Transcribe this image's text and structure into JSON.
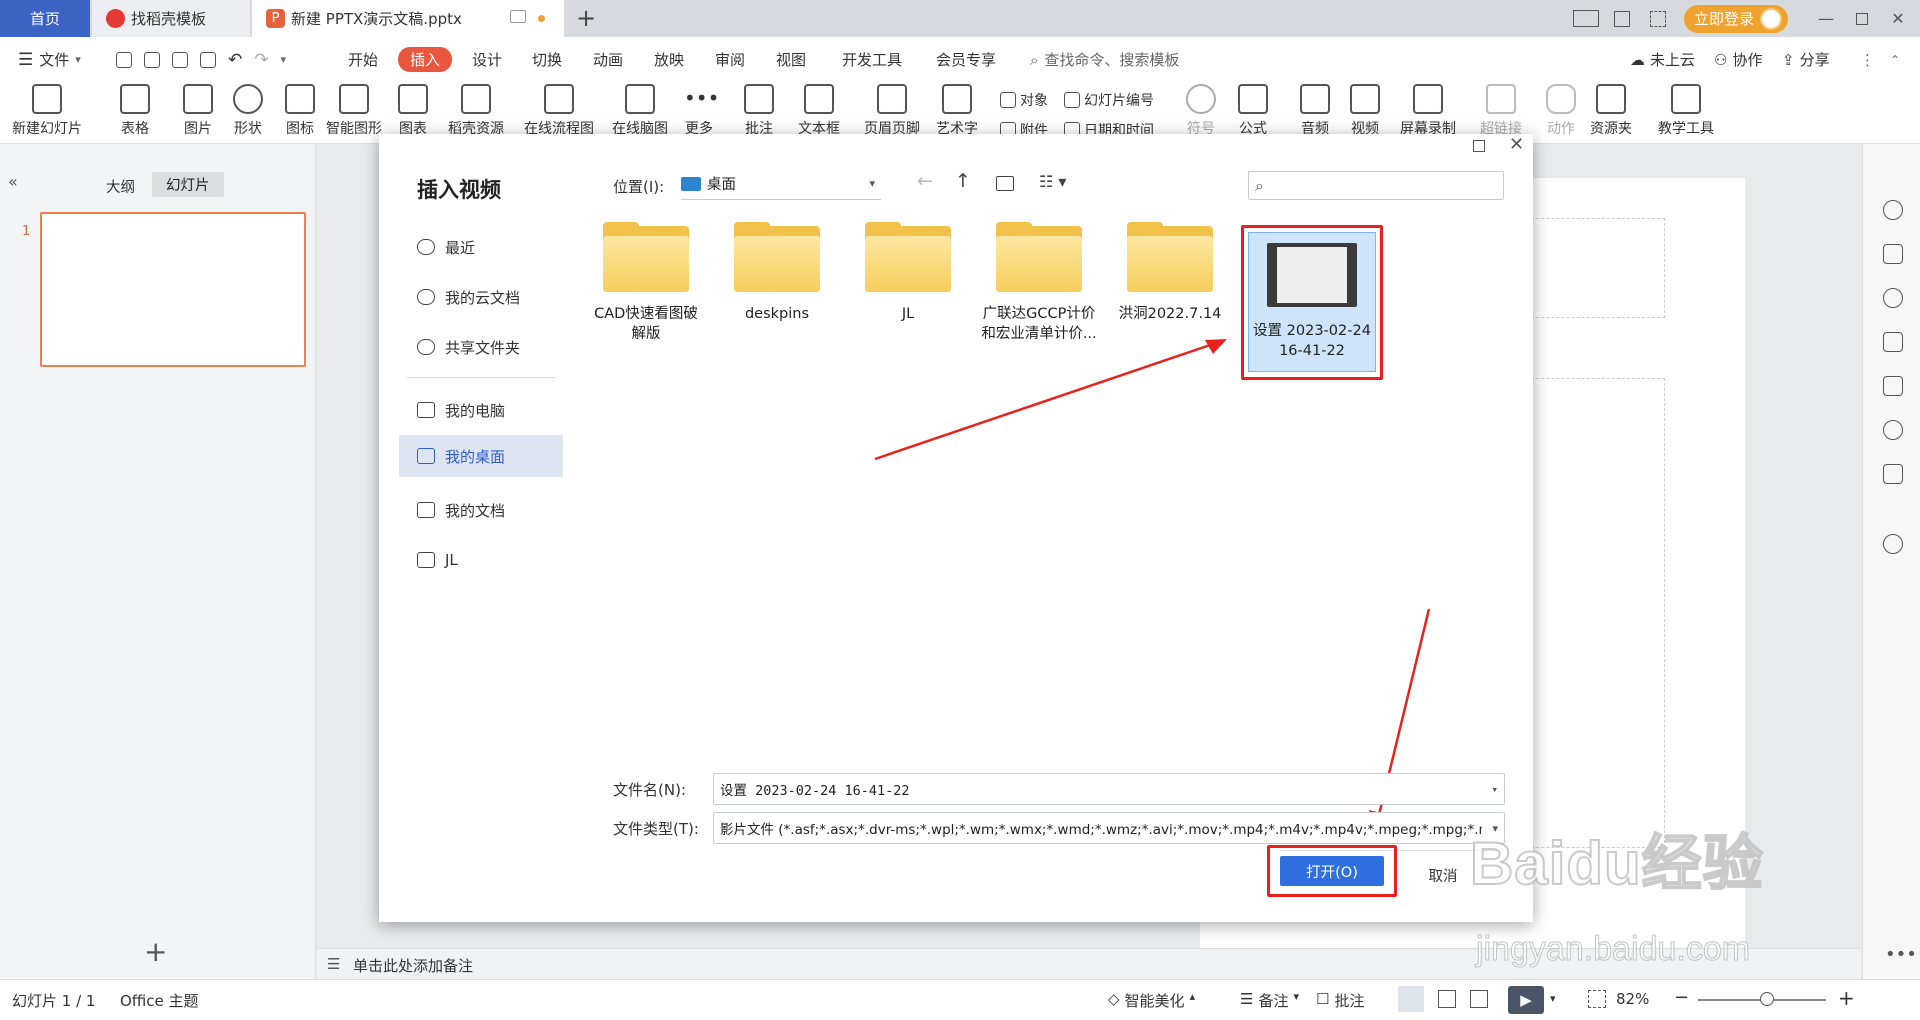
{
  "titlebar": {
    "home_tab": "首页",
    "template_tab": "找稻壳模板",
    "doc_tab": "新建 PPTX演示文稿.pptx",
    "login": "立即登录",
    "new_tab_icon": "plus-icon"
  },
  "menu": {
    "file": "文件",
    "items": [
      "开始",
      "插入",
      "设计",
      "切换",
      "动画",
      "放映",
      "审阅",
      "视图",
      "开发工具",
      "会员专享"
    ],
    "active": "插入",
    "search": "查找命令、搜索模板",
    "cloud": "未上云",
    "collab": "协作",
    "share": "分享"
  },
  "ribbon": {
    "new_slide": "新建幻灯片",
    "table": "表格",
    "picture": "图片",
    "shape": "形状",
    "icon": "图标",
    "smartart": "智能图形",
    "chart": "图表",
    "material": "稻壳资源",
    "flowchart": "在线流程图",
    "mindmap": "在线脑图",
    "more": "更多",
    "comment": "批注",
    "textbox": "文本框",
    "header_footer": "页眉页脚",
    "wordart": "艺术字",
    "object": "对象",
    "slide_number": "幻灯片编号",
    "attachment": "附件",
    "datetime": "日期和时间",
    "symbol": "符号",
    "formula": "公式",
    "audio": "音频",
    "video": "视频",
    "screen_record": "屏幕录制",
    "hyperlink": "超链接",
    "action": "动作",
    "resource": "资源夹",
    "teaching": "教学工具"
  },
  "leftpanel": {
    "outline_tab": "大纲",
    "slides_tab": "幻灯片",
    "slide_num": "1",
    "add": "+"
  },
  "notes": "单击此处添加备注",
  "status": {
    "slide_info": "幻灯片 1 / 1",
    "theme": "Office 主题",
    "beautify": "智能美化",
    "notes": "备注",
    "comment": "批注",
    "zoom": "82%"
  },
  "dialog": {
    "title": "插入视频",
    "location_label": "位置(I):",
    "location_value": "桌面",
    "search_placeholder": "",
    "nav": [
      "最近",
      "我的云文档",
      "共享文件夹",
      "我的电脑",
      "我的桌面",
      "我的文档",
      "JL"
    ],
    "nav_selected": "我的桌面",
    "files": [
      {
        "name": "CAD快速看图破解版",
        "type": "folder"
      },
      {
        "name": "deskpins",
        "type": "folder"
      },
      {
        "name": "JL",
        "type": "folder"
      },
      {
        "name": "广联达GCCP计价和宏业清单计价...",
        "type": "folder"
      },
      {
        "name": "洪洞2022.7.14",
        "type": "folder"
      },
      {
        "name": "设置 2023-02-24 16-41-22",
        "type": "video"
      }
    ],
    "filename_label": "文件名(N):",
    "filename_value": "设置 2023-02-24 16-41-22",
    "filetype_label": "文件类型(T):",
    "filetype_value": "影片文件 (*.asf;*.asx;*.dvr-ms;*.wpl;*.wm;*.wmx;*.wmd;*.wmz;*.avi;*.mov;*.mp4;*.m4v;*.mp4v;*.mpeg;*.mpg;*.m",
    "open": "打开(O)",
    "cancel": "取消"
  },
  "watermark": {
    "logo": "Baidu经验",
    "url": "jingyan.baidu.com"
  },
  "colors": {
    "accent_red": "#e8211c",
    "tab_active": "#e9573f",
    "primary_blue": "#2f6fe0",
    "login_orange": "#f0a22e"
  }
}
